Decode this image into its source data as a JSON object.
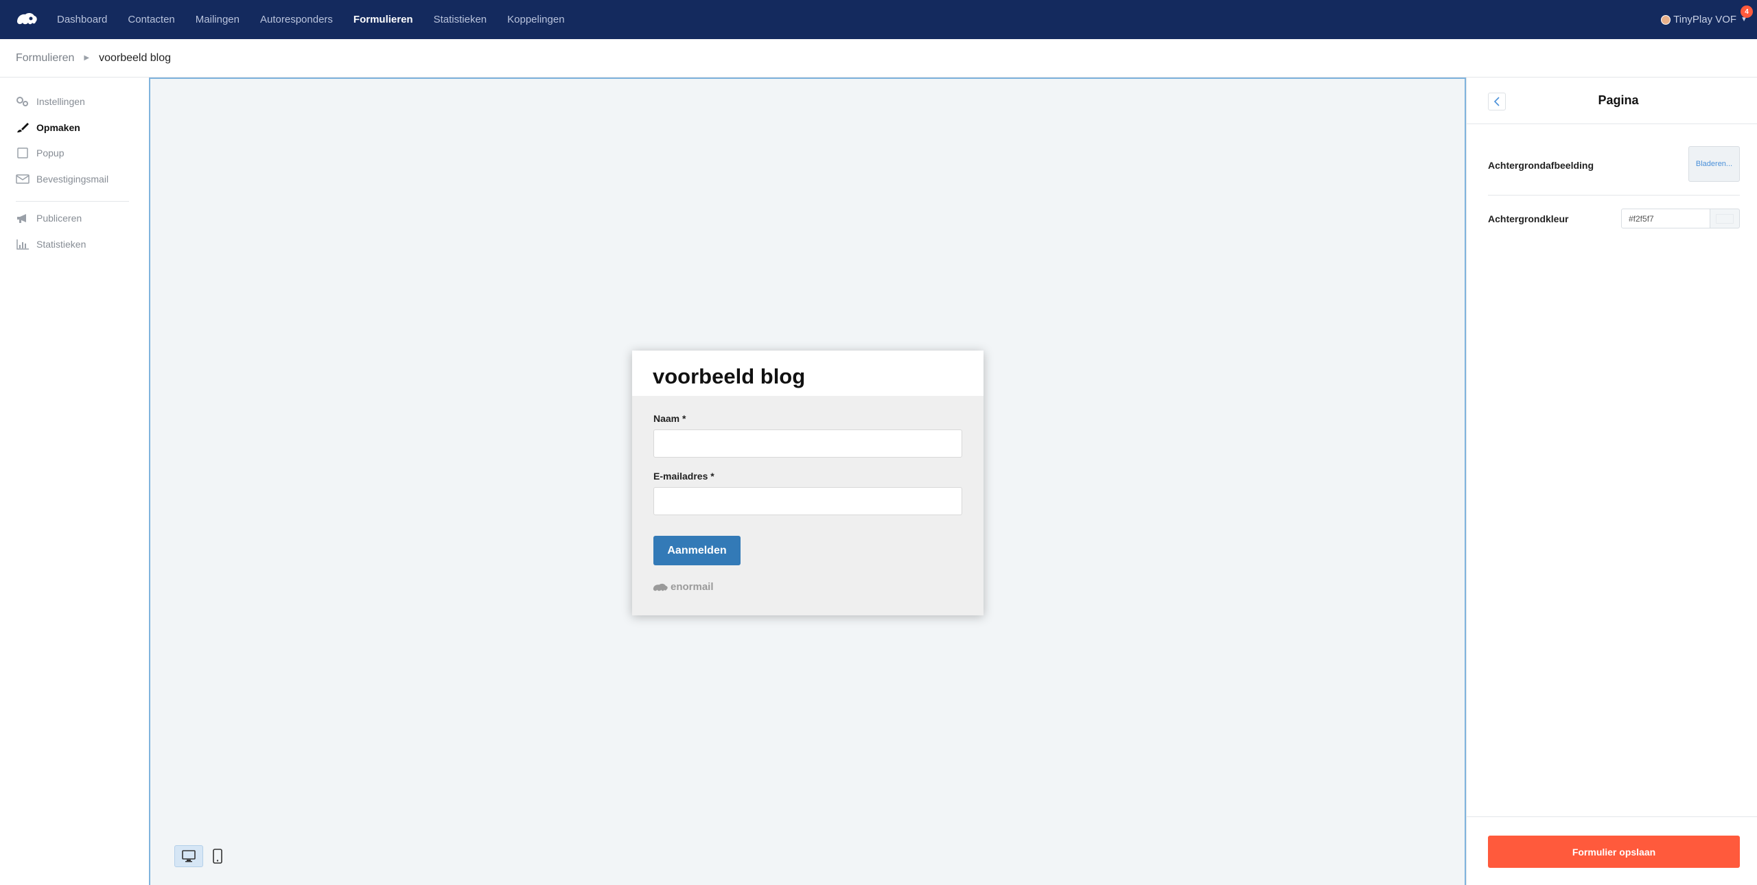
{
  "topnav": {
    "items": [
      {
        "label": "Dashboard",
        "active": false
      },
      {
        "label": "Contacten",
        "active": false
      },
      {
        "label": "Mailingen",
        "active": false
      },
      {
        "label": "Autoresponders",
        "active": false
      },
      {
        "label": "Formulieren",
        "active": true
      },
      {
        "label": "Statistieken",
        "active": false
      },
      {
        "label": "Koppelingen",
        "active": false
      }
    ],
    "account_name": "TinyPlay VOF",
    "notification_count": "4"
  },
  "breadcrumb": {
    "parent": "Formulieren",
    "current": "voorbeeld blog"
  },
  "sidebar": {
    "items": [
      {
        "label": "Instellingen",
        "icon": "gears-icon"
      },
      {
        "label": "Opmaken",
        "icon": "paintbrush-icon",
        "active": true
      },
      {
        "label": "Popup",
        "icon": "square-icon"
      },
      {
        "label": "Bevestigingsmail",
        "icon": "envelope-icon"
      },
      {
        "label": "Publiceren",
        "icon": "megaphone-icon"
      },
      {
        "label": "Statistieken",
        "icon": "chart-icon"
      }
    ]
  },
  "form": {
    "title": "voorbeeld blog",
    "fields": [
      {
        "label": "Naam *",
        "value": ""
      },
      {
        "label": "E-mailadres *",
        "value": ""
      }
    ],
    "submit_label": "Aanmelden",
    "powered_by": "enormail"
  },
  "panel": {
    "title": "Pagina",
    "background_image_label": "Achtergrondafbeelding",
    "browse_label": "Bladeren...",
    "background_color_label": "Achtergrondkleur",
    "background_color_value": "#f2f5f7",
    "save_label": "Formulier opslaan"
  },
  "colors": {
    "nav_bg": "#142a5e",
    "canvas_bg": "#f2f5f7",
    "primary_button": "#337ab7",
    "save_button": "#ff5a3c",
    "canvas_border": "#7fb3dd"
  }
}
